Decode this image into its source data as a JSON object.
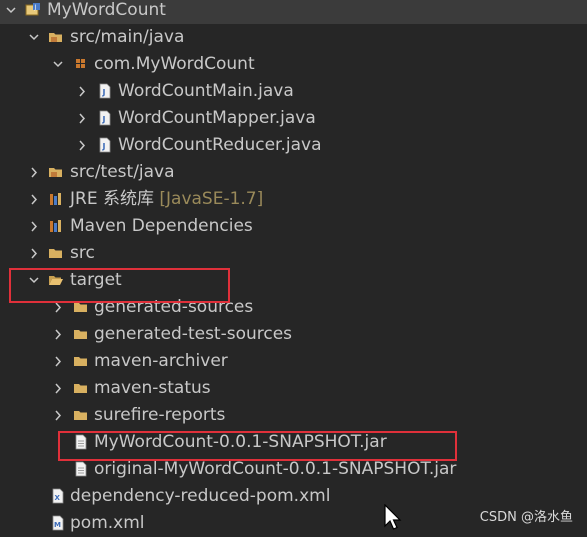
{
  "tree": {
    "items": [
      {
        "label": "MyWordCount",
        "suffix": "",
        "icon": "java-project-icon",
        "expanded": true,
        "selected": true
      },
      {
        "label": "src/main/java",
        "suffix": "",
        "icon": "source-folder-icon",
        "expanded": true
      },
      {
        "label": "com.MyWordCount",
        "suffix": "",
        "icon": "package-icon",
        "expanded": true
      },
      {
        "label": "WordCountMain.java",
        "suffix": "",
        "icon": "java-file-icon",
        "expanded": false
      },
      {
        "label": "WordCountMapper.java",
        "suffix": "",
        "icon": "java-file-icon",
        "expanded": false
      },
      {
        "label": "WordCountReducer.java",
        "suffix": "",
        "icon": "java-file-icon",
        "expanded": false
      },
      {
        "label": "src/test/java",
        "suffix": "",
        "icon": "source-folder-icon",
        "expanded": false
      },
      {
        "label": "JRE 系统库 ",
        "suffix": "[JavaSE-1.7]",
        "icon": "library-icon",
        "expanded": false
      },
      {
        "label": "Maven Dependencies",
        "suffix": "",
        "icon": "library-icon",
        "expanded": false
      },
      {
        "label": "src",
        "suffix": "",
        "icon": "folder-icon",
        "expanded": false
      },
      {
        "label": "target",
        "suffix": "",
        "icon": "folder-icon",
        "expanded": true
      },
      {
        "label": "generated-sources",
        "suffix": "",
        "icon": "folder-icon",
        "expanded": false
      },
      {
        "label": "generated-test-sources",
        "suffix": "",
        "icon": "folder-icon",
        "expanded": false
      },
      {
        "label": "maven-archiver",
        "suffix": "",
        "icon": "folder-icon",
        "expanded": false
      },
      {
        "label": "maven-status",
        "suffix": "",
        "icon": "folder-icon",
        "expanded": false
      },
      {
        "label": "surefire-reports",
        "suffix": "",
        "icon": "folder-icon",
        "expanded": false
      },
      {
        "label": "MyWordCount-0.0.1-SNAPSHOT.jar",
        "suffix": "",
        "icon": "file-icon",
        "expanded": false
      },
      {
        "label": "original-MyWordCount-0.0.1-SNAPSHOT.jar",
        "suffix": "",
        "icon": "file-icon",
        "expanded": false
      },
      {
        "label": "dependency-reduced-pom.xml",
        "suffix": "",
        "icon": "xml-file-icon",
        "expanded": false
      },
      {
        "label": "pom.xml",
        "suffix": "",
        "icon": "xml-file-icon",
        "expanded": false
      }
    ]
  },
  "watermark": "CSDN @洛水鱼",
  "colors": {
    "background": "#262626",
    "text": "#c8c8c8",
    "highlight_box": "#e0303a",
    "folder": "#d8b060",
    "suffix": "#9a8a5a"
  }
}
